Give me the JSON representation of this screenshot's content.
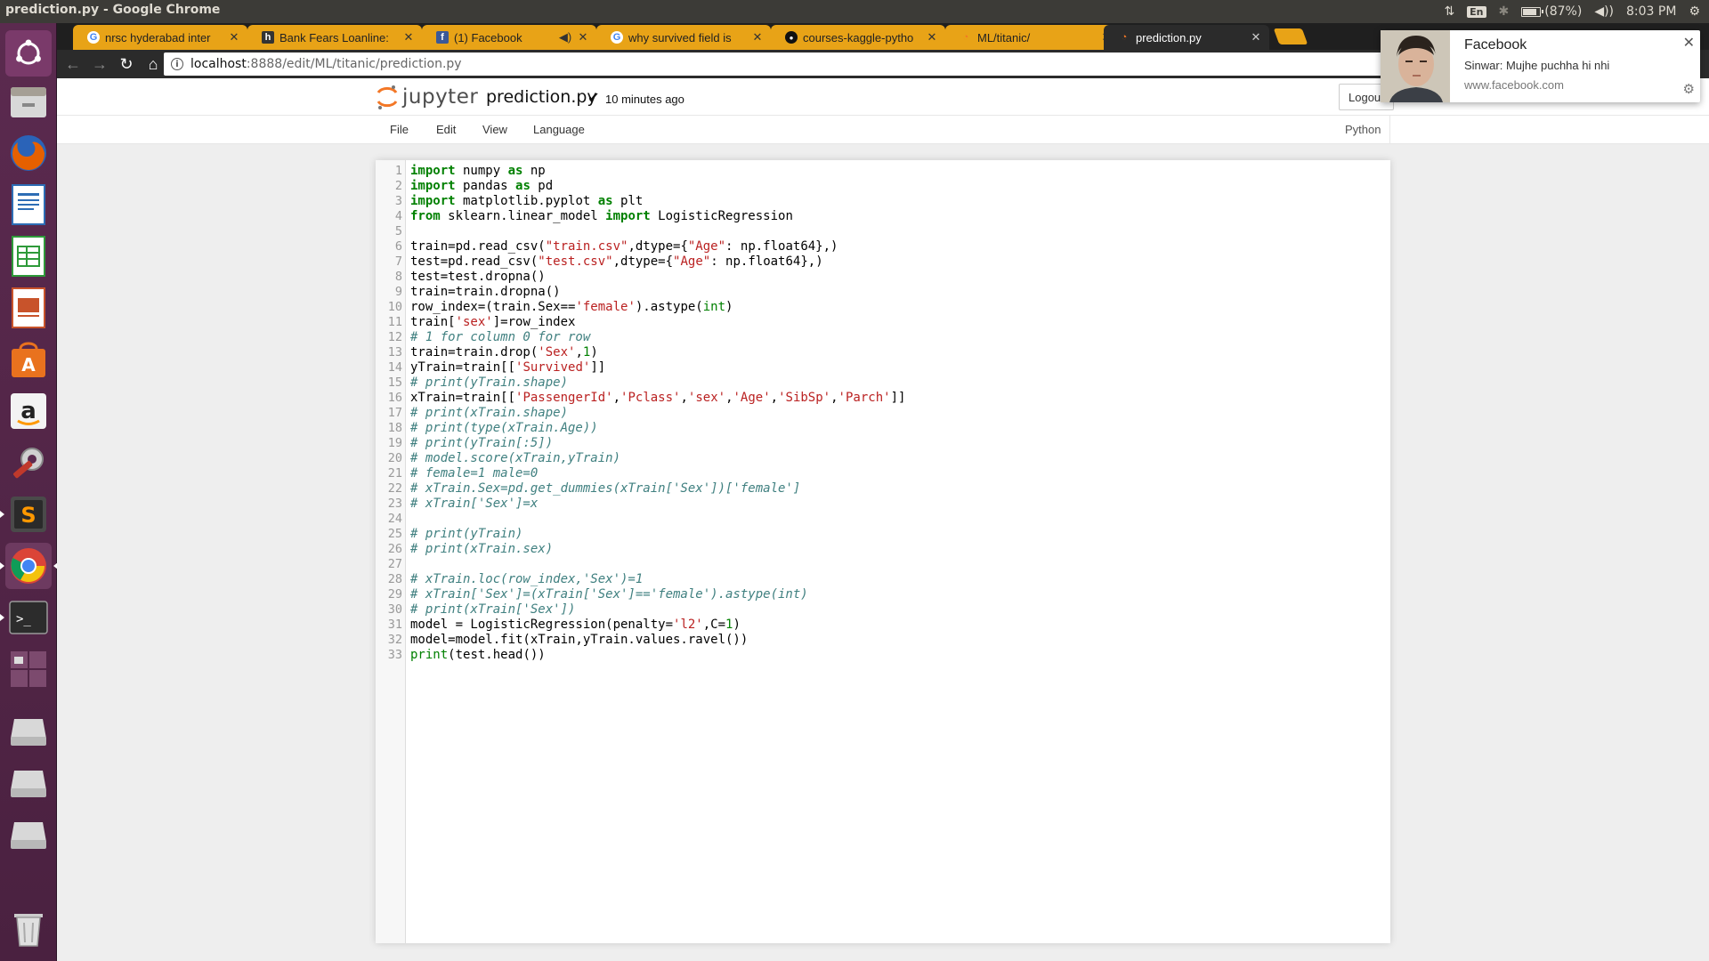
{
  "system": {
    "window_title": "prediction.py - Google Chrome",
    "keyboard_layout": "En",
    "battery": "(87%)",
    "battery_level": 0.87,
    "clock": "8:03 PM"
  },
  "launcher": {
    "items": [
      {
        "name": "ubuntu-dash-icon"
      },
      {
        "name": "files-icon"
      },
      {
        "name": "firefox-icon"
      },
      {
        "name": "writer-icon"
      },
      {
        "name": "calc-icon"
      },
      {
        "name": "impress-icon"
      },
      {
        "name": "software-center-icon"
      },
      {
        "name": "amazon-icon"
      },
      {
        "name": "system-settings-icon"
      },
      {
        "name": "sublime-text-icon"
      },
      {
        "name": "chrome-icon"
      },
      {
        "name": "terminal-icon"
      },
      {
        "name": "workspace-switcher-icon"
      },
      {
        "name": "drive-icon"
      },
      {
        "name": "drive-icon"
      },
      {
        "name": "drive-icon"
      },
      {
        "name": "trash-icon"
      }
    ]
  },
  "tabs": [
    {
      "label": "nrsc hyderabad inter",
      "favicon": "G"
    },
    {
      "label": "Bank Fears Loanline:",
      "favicon": "h"
    },
    {
      "label": "(1) Facebook",
      "favicon": "f"
    },
    {
      "label": "why survived field is",
      "favicon": "G"
    },
    {
      "label": "courses-kaggle-pytho",
      "favicon": "gh"
    },
    {
      "label": "ML/titanic/",
      "favicon": "jp"
    },
    {
      "label": "prediction.py",
      "favicon": "jp"
    }
  ],
  "omnibox": {
    "host": "localhost",
    "path": ":8888/edit/ML/titanic/prediction.py"
  },
  "jupyter": {
    "logo_text": "jupyter",
    "filename": "prediction.py",
    "save_status": "10 minutes ago",
    "logout_label": "Logout",
    "menu": [
      "File",
      "Edit",
      "View",
      "Language"
    ],
    "kernel": "Python"
  },
  "code_lines": [
    "import numpy as np",
    "import pandas as pd",
    "import matplotlib.pyplot as plt",
    "from sklearn.linear_model import LogisticRegression",
    "",
    "train=pd.read_csv(\"train.csv\",dtype={\"Age\": np.float64},)",
    "test=pd.read_csv(\"test.csv\",dtype={\"Age\": np.float64},)",
    "test=test.dropna()",
    "train=train.dropna()",
    "row_index=(train.Sex=='female').astype(int)",
    "train['sex']=row_index",
    "# 1 for column 0 for row",
    "train=train.drop('Sex',1)",
    "yTrain=train[['Survived']]",
    "# print(yTrain.shape)",
    "xTrain=train[['PassengerId','Pclass','sex','Age','SibSp','Parch']]",
    "# print(xTrain.shape)",
    "# print(type(xTrain.Age))",
    "# print(yTrain[:5])",
    "# model.score(xTrain,yTrain)",
    "# female=1 male=0",
    "# xTrain.Sex=pd.get_dummies(xTrain['Sex'])['female']",
    "# xTrain['Sex']=x",
    "",
    "# print(yTrain)",
    "# print(xTrain.sex)",
    "",
    "# xTrain.loc(row_index,'Sex')=1",
    "# xTrain['Sex']=(xTrain['Sex']=='female').astype(int)",
    "# print(xTrain['Sex'])",
    "model = LogisticRegression(penalty='l2',C=1)",
    "model=model.fit(xTrain,yTrain.values.ravel())",
    "print(test.head())"
  ],
  "notification": {
    "title": "Facebook",
    "body": "Sinwar: Mujhe puchha hi nhi",
    "url": "www.facebook.com"
  }
}
